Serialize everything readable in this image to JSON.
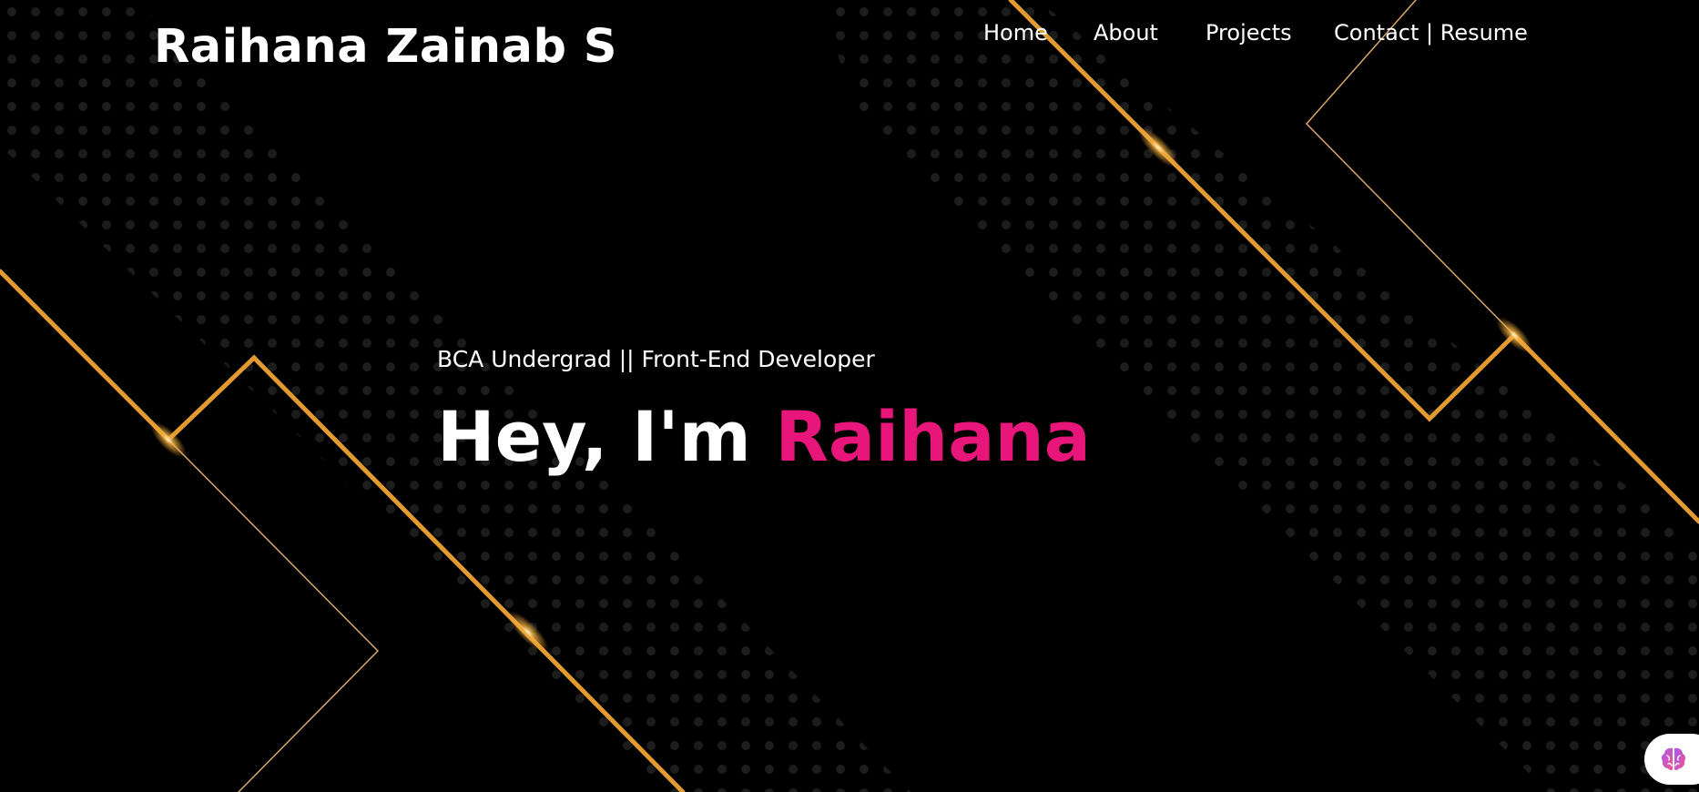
{
  "header": {
    "brand": "Raihana Zainab S",
    "nav": [
      {
        "label": "Home"
      },
      {
        "label": "About"
      },
      {
        "label": "Projects"
      },
      {
        "label": "Contact | Resume"
      }
    ]
  },
  "hero": {
    "subtitle": "BCA Undergrad || Front-End Developer",
    "greeting": "Hey, I'm ",
    "name": "Raihana"
  },
  "theme": {
    "background": "#000000",
    "accent": "#e8157a",
    "gold": "#e39a2f"
  },
  "widget": {
    "icon": "brain-icon"
  }
}
